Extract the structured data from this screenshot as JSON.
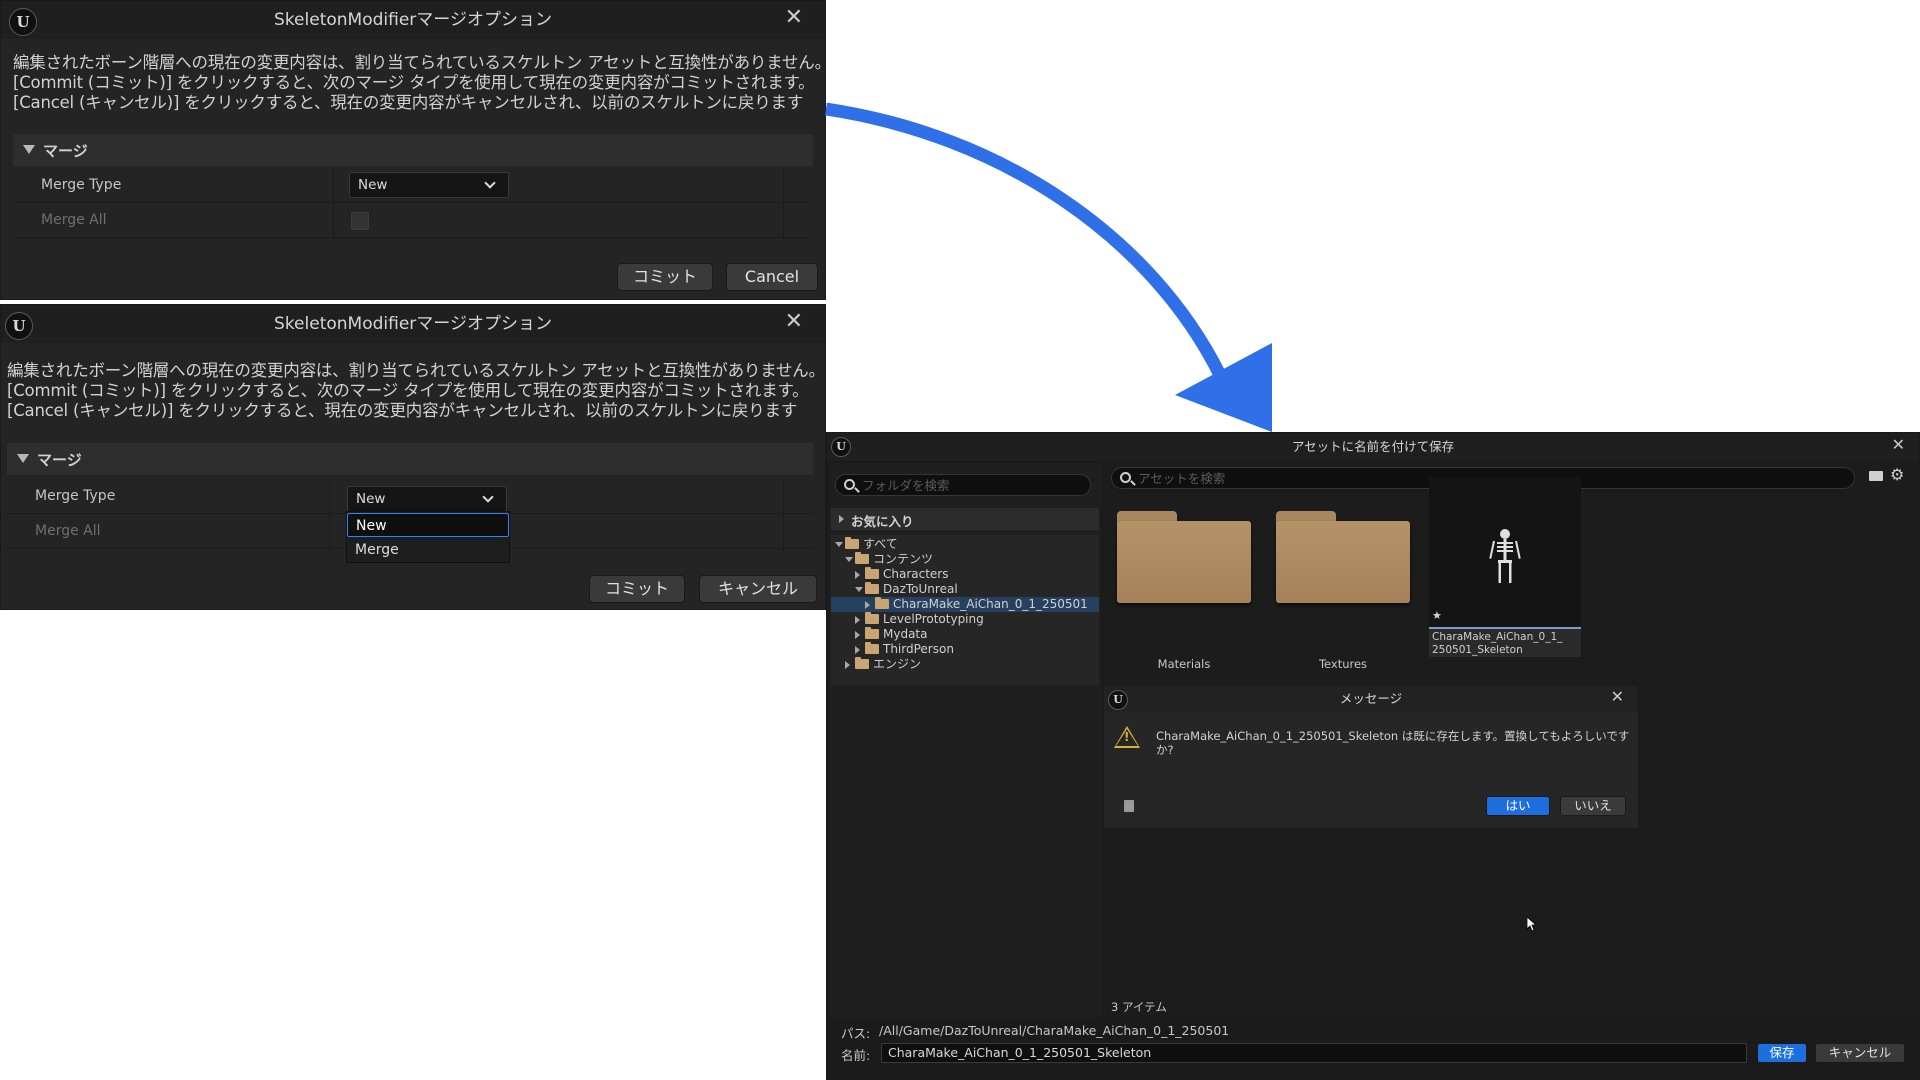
{
  "dialog_top": {
    "title": "SkeletonModifierマージオプション",
    "message": [
      "編集されたボーン階層への現在の変更内容は、割り当てられているスケルトン アセットと互換性がありません。",
      "[Commit (コミット)] をクリックすると、次のマージ タイプを使用して現在の変更内容がコミットされます。",
      "[Cancel (キャンセル)] をクリックすると、現在の変更内容がキャンセルされ、以前のスケルトンに戻ります"
    ],
    "section_label": "マージ",
    "merge_type_label": "Merge Type",
    "merge_type_value": "New",
    "merge_all_label": "Merge All",
    "commit_label": "コミット",
    "cancel_label": "Cancel"
  },
  "dialog_bottom": {
    "title": "SkeletonModifierマージオプション",
    "message": [
      "編集されたボーン階層への現在の変更内容は、割り当てられているスケルトン アセットと互換性がありません。",
      "[Commit (コミット)] をクリックすると、次のマージ タイプを使用して現在の変更内容がコミットされます。",
      "[Cancel (キャンセル)] をクリックすると、現在の変更内容がキャンセルされ、以前のスケルトンに戻ります"
    ],
    "section_label": "マージ",
    "merge_type_label": "Merge Type",
    "merge_type_value": "New",
    "merge_all_label": "Merge All",
    "dropdown_options": [
      "New",
      "Merge"
    ],
    "commit_label": "コミット",
    "cancel_label": "キャンセル"
  },
  "save_dialog": {
    "title": "アセットに名前を付けて保存",
    "folder_search_placeholder": "フォルダを検索",
    "asset_search_placeholder": "アセットを検索",
    "favorites_label": "お気に入り",
    "tree": {
      "all": "すべて",
      "content": "コンテンツ",
      "characters": "Characters",
      "daztounreal": "DazToUnreal",
      "charamake": "CharaMake_AiChan_0_1_250501",
      "levelprototyping": "LevelPrototyping",
      "mydata": "Mydata",
      "thirdperson": "ThirdPerson",
      "engine": "エンジン"
    },
    "tiles": {
      "materials": "Materials",
      "textures": "Textures",
      "skeleton_line1": "CharaMake_AiChan_0_1_",
      "skeleton_line2": "250501_Skeleton"
    },
    "item_count": "3 アイテム",
    "path_label": "パス:",
    "path_value": "/All/Game/DazToUnreal/CharaMake_AiChan_0_1_250501",
    "name_label": "名前:",
    "name_value": "CharaMake_AiChan_0_1_250501_Skeleton",
    "save_label": "保存",
    "cancel_label": "キャンセル",
    "message": {
      "title": "メッセージ",
      "line1": "CharaMake_AiChan_0_1_250501_Skeleton は既に存在します。置換してもよろしいです",
      "line2": "か?",
      "yes_label": "はい",
      "no_label": "いいえ"
    }
  },
  "colors": {
    "arrow": "#2f6fe8",
    "accent": "#1d6fe0",
    "dialog_bg": "#242424"
  }
}
